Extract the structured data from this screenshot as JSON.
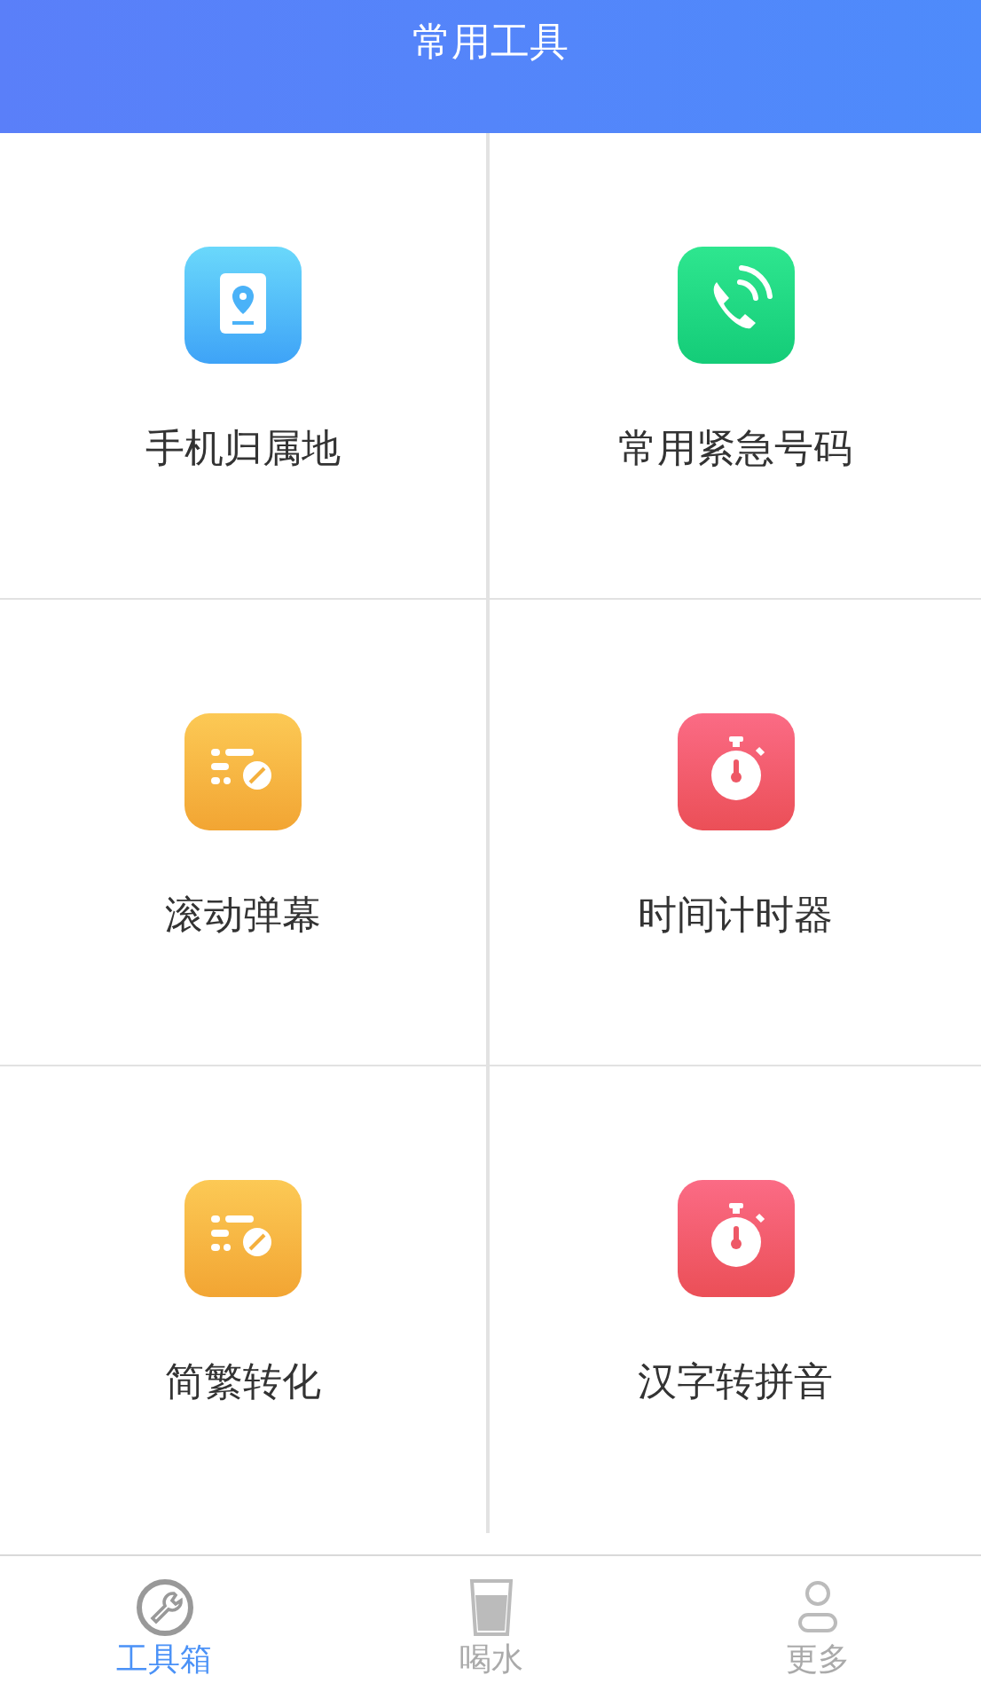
{
  "header": {
    "title": "常用工具"
  },
  "tools": [
    {
      "label": "手机归属地",
      "kind": "location"
    },
    {
      "label": "常用紧急号码",
      "kind": "phone"
    },
    {
      "label": "滚动弹幕",
      "kind": "list"
    },
    {
      "label": "时间计时器",
      "kind": "timer"
    },
    {
      "label": "简繁转化",
      "kind": "list"
    },
    {
      "label": "汉字转拼音",
      "kind": "timer"
    }
  ],
  "tabs": [
    {
      "label": "工具箱",
      "kind": "wrench",
      "selected": true
    },
    {
      "label": "喝水",
      "kind": "glass",
      "selected": false
    },
    {
      "label": "更多",
      "kind": "person",
      "selected": false
    }
  ]
}
